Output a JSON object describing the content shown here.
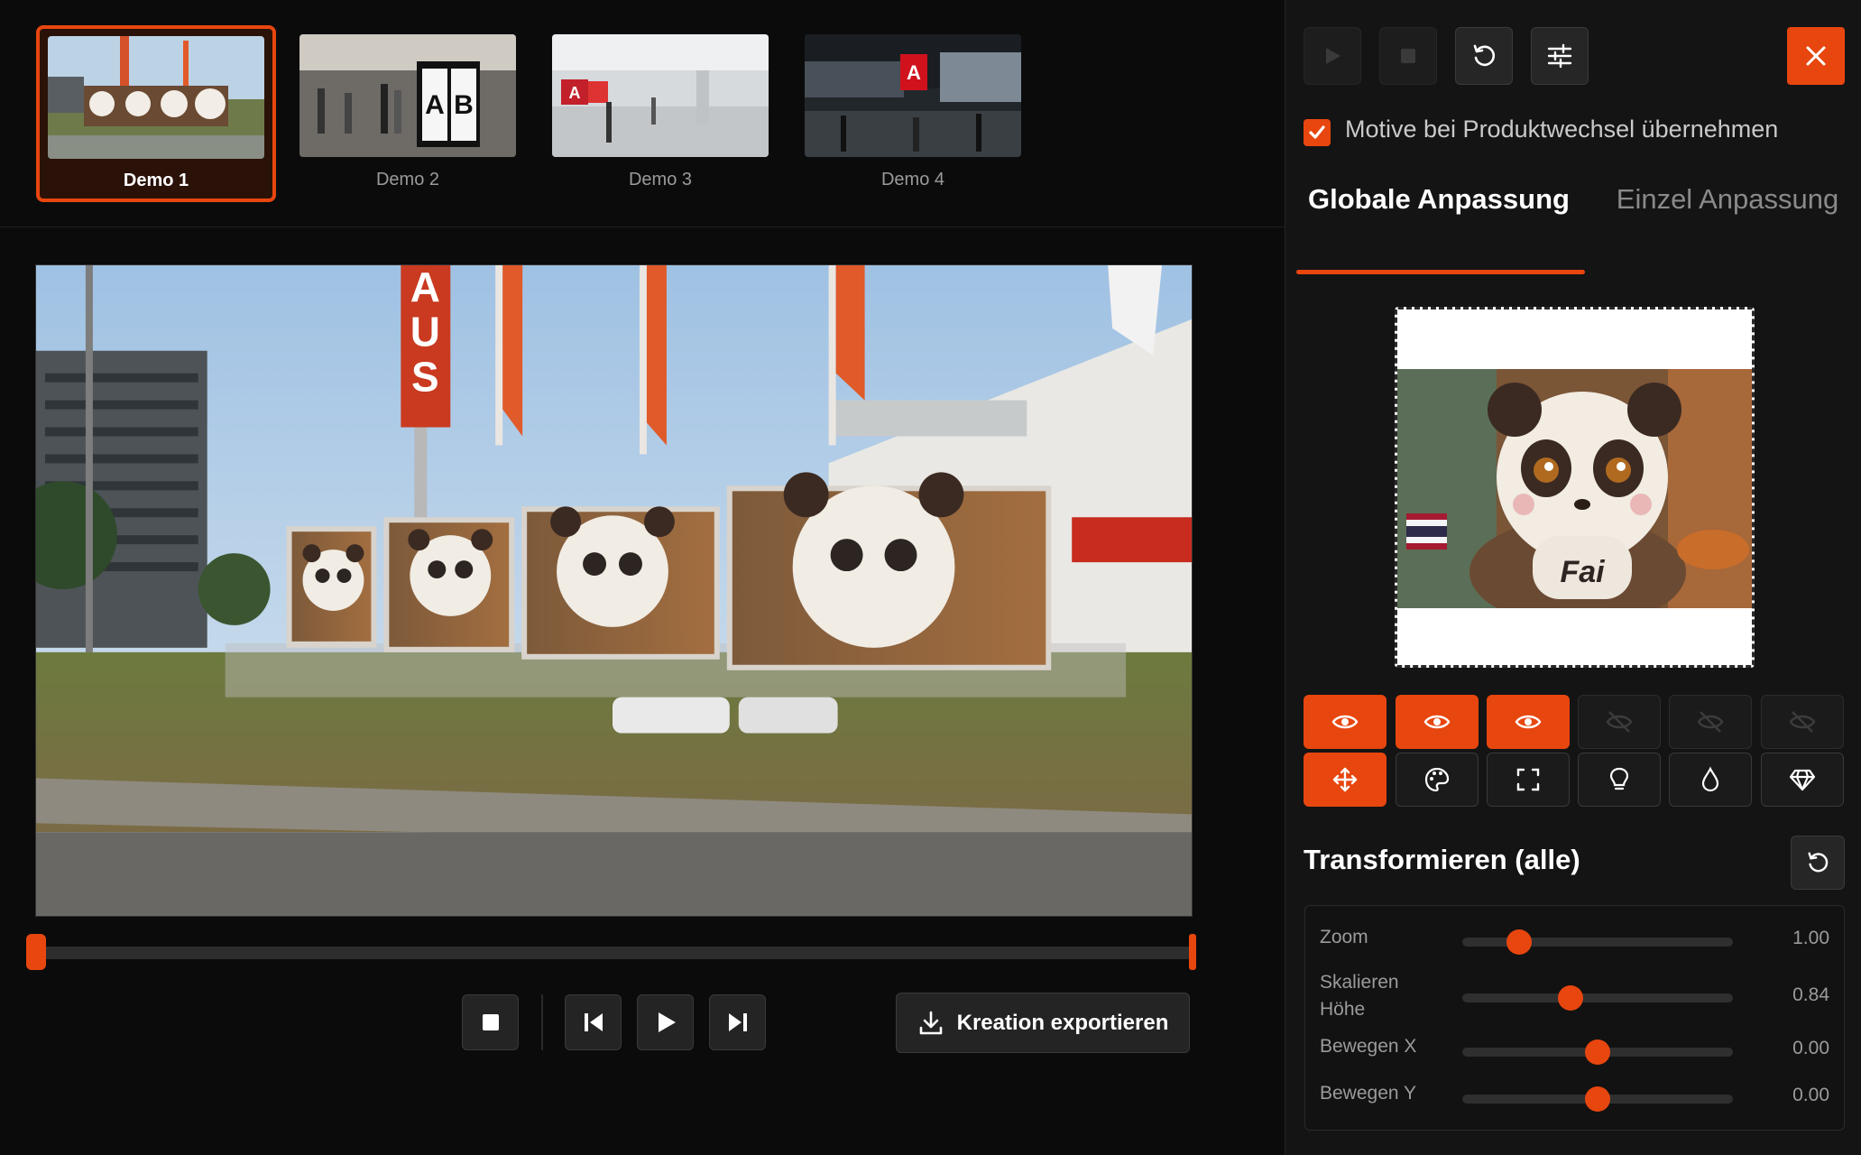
{
  "thumbnails": [
    {
      "label": "Demo 1",
      "active": true
    },
    {
      "label": "Demo 2",
      "active": false
    },
    {
      "label": "Demo 3",
      "active": false
    },
    {
      "label": "Demo 4",
      "active": false
    }
  ],
  "player": {
    "timeline_progress": 0.0,
    "export_label": "Kreation exportieren"
  },
  "panel": {
    "sync_checked": true,
    "sync_label": "Motive bei Produktwechsel übernehmen",
    "tabs": [
      {
        "label": "Globale Anpassung",
        "active": true
      },
      {
        "label": "Einzel Anpassung",
        "active": false
      }
    ],
    "visibility_toggles": [
      {
        "icon": "eye-icon",
        "on": true
      },
      {
        "icon": "eye-icon",
        "on": true
      },
      {
        "icon": "eye-icon",
        "on": true
      },
      {
        "icon": "eye-off-icon",
        "on": false
      },
      {
        "icon": "eye-off-icon",
        "on": false
      },
      {
        "icon": "eye-off-icon",
        "on": false
      }
    ],
    "tools": [
      {
        "icon": "move-icon",
        "on": true
      },
      {
        "icon": "palette-icon",
        "on": false
      },
      {
        "icon": "crop-frame-icon",
        "on": false
      },
      {
        "icon": "lightbulb-icon",
        "on": false
      },
      {
        "icon": "droplet-icon",
        "on": false
      },
      {
        "icon": "diamond-icon",
        "on": false
      }
    ],
    "section_title": "Transformieren (alle)",
    "sliders": [
      {
        "label": "Zoom",
        "value": "1.00",
        "position": 0.21
      },
      {
        "label": "Skalieren Höhe",
        "value": "0.84",
        "position": 0.4
      },
      {
        "label": "Bewegen X",
        "value": "0.00",
        "position": 0.5
      },
      {
        "label": "Bewegen Y",
        "value": "0.00",
        "position": 0.5
      }
    ]
  },
  "colors": {
    "accent": "#e8460f",
    "background": "#0b0b0b",
    "panel": "#141414"
  }
}
